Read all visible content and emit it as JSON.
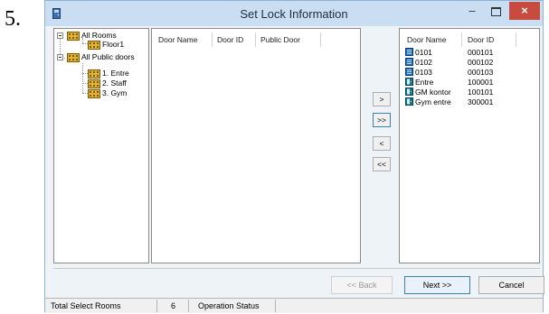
{
  "step_number": "5.",
  "window": {
    "title": "Set Lock Information",
    "minimize": "–",
    "close": "×"
  },
  "tree": [
    {
      "label": "All Rooms"
    },
    {
      "label": "Floor1"
    },
    {
      "label": "All Public doors"
    },
    {
      "label": "1. Entre"
    },
    {
      "label": "2. Staff"
    },
    {
      "label": "3. Gym"
    }
  ],
  "available_list": {
    "headers": [
      "Door Name",
      "Door ID",
      "Public Door"
    ],
    "rows": []
  },
  "move_buttons": [
    ">",
    ">>",
    "<",
    "<<"
  ],
  "selected_list": {
    "headers": [
      "Door Name",
      "Door ID"
    ],
    "rows": [
      {
        "name": "0101",
        "id": "000101",
        "icon": "room-door-icon"
      },
      {
        "name": "0102",
        "id": "000102",
        "icon": "room-door-icon"
      },
      {
        "name": "0103",
        "id": "000103",
        "icon": "room-door-icon"
      },
      {
        "name": "Entre",
        "id": "100001",
        "icon": "public-door-icon"
      },
      {
        "name": "GM kontor",
        "id": "100101",
        "icon": "public-door-icon"
      },
      {
        "name": "Gym entre",
        "id": "300001",
        "icon": "public-door-icon"
      }
    ]
  },
  "buttons": {
    "back": "<< Back",
    "next": "Next >>",
    "cancel": "Cancel"
  },
  "status": {
    "total_label": "Total Select Rooms",
    "total_value": "6",
    "operation_label": "Operation Status"
  },
  "colors": {
    "titlebar": "#c9def3",
    "close": "#c74b3e",
    "room_icon": "#1f6fc4",
    "public_icon": "#137a93",
    "building_icon": "#d8a21b"
  }
}
